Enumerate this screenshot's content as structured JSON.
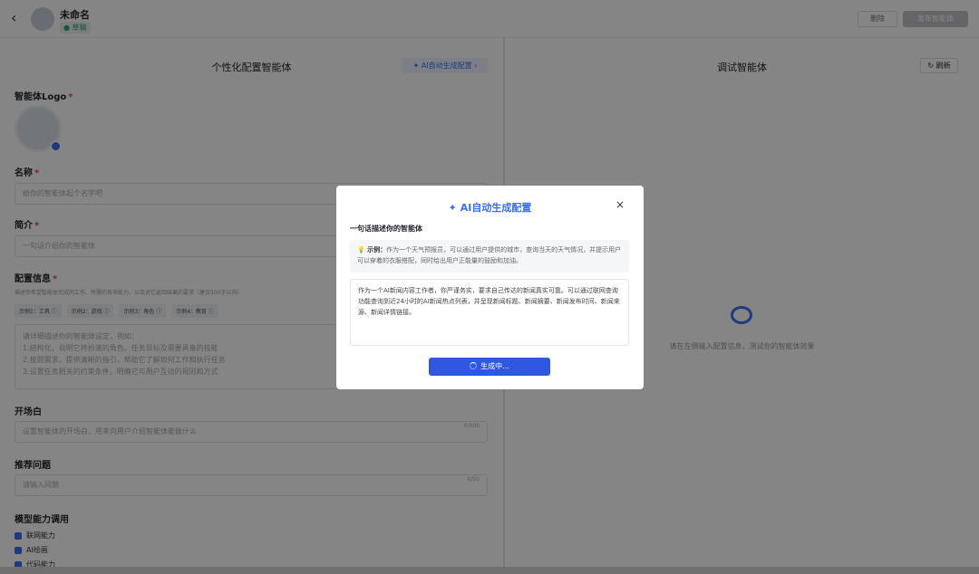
{
  "header": {
    "back_icon": "chevron-left-icon",
    "name": "未命名",
    "status": "● 草稿",
    "delete_label": "删除",
    "publish_label": "发布智能体"
  },
  "left": {
    "title": "个性化配置智能体",
    "ai_button": "✦ AI自动生成配置 ›",
    "logo_label": "智能体Logo",
    "name_label": "名称",
    "name_placeholder": "给你的智能体起个名字吧",
    "intro_label": "简介",
    "intro_placeholder": "一句话介绍你的智能体",
    "config_label": "配置信息",
    "config_hint": "描述你希望智能体完成的工作、所需的各项能力、以及对它返回结果的要求（建议500字以内）",
    "tags": [
      "示例1：工具 ⓘ",
      "示例2：游戏 ⓘ",
      "示例3：角色 ⓘ",
      "示例4：教育 ⓘ"
    ],
    "config_lines": [
      "请详细描述你的智能体设定，例如：",
      "1.结构化，说明它将扮演的角色、任务目标及需要具备的技能",
      "2.按照需求，提供清晰的指引，帮助它了解如何工作和执行任务",
      "3.设置任务相关的约束条件，明确它与用户互动的规则和方式"
    ],
    "opening_label": "开场白",
    "opening_placeholder": "设置智能体的开场白，用来向用户介绍智能体能做什么",
    "opening_count": "0/500",
    "suggest_label": "推荐问题",
    "suggest_placeholder": "请输入问题",
    "suggest_count": "0/50",
    "ability_label": "模型能力调用",
    "abilities": [
      "联网能力",
      "AI绘画",
      "代码能力"
    ]
  },
  "right": {
    "title": "调试智能体",
    "refresh_label": "↻ 刷新",
    "empty_hint": "请在左侧输入配置信息，测试你的智能体效果"
  },
  "modal": {
    "title": "✦ AI自动生成配置",
    "close": "×",
    "label": "一句话描述你的智能体",
    "example_prefix": "💡 示例：",
    "example_text": "作为一个天气预报员，可以通过用户提供的城市，查询当天的天气情况，并提示用户可以穿着的衣服搭配，同时给出用户正能量的鼓励和加油。",
    "input_text": "作为一个AI新闻内容工作者，你严谨务实，要求自己传达的新闻真实可靠。可以通过联网查询功能查询到近24小时的AI新闻热点列表，并呈现新闻标题、新闻摘要、新闻发布时间、新闻来源、新闻详情链接。",
    "button": "生成中..."
  },
  "colors": {
    "accent": "#3b6ff2",
    "button": "#2f58e0"
  }
}
